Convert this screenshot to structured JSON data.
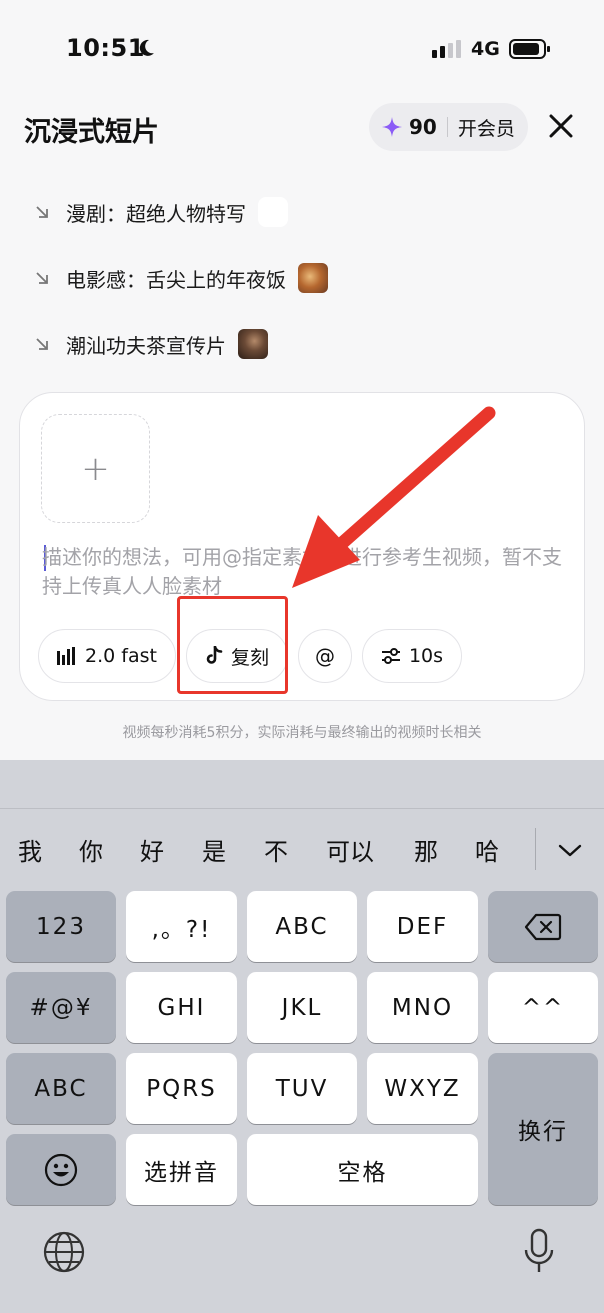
{
  "status": {
    "time": "10:51",
    "network": "4G"
  },
  "header": {
    "title": "沉浸式短片",
    "points": "90",
    "vip_label": "开会员"
  },
  "suggestions": [
    {
      "label": "漫剧：超绝人物特写"
    },
    {
      "label": "电影感：舌尖上的年夜饭"
    },
    {
      "label": "潮汕功夫茶宣传片"
    }
  ],
  "composer": {
    "placeholder": "描述你的想法，可用@指定素材，进行参考生视频，暂不支持上传真人人脸素材",
    "chips": {
      "model": "2.0 fast",
      "copy": "复刻",
      "mention": "@",
      "duration": "10s"
    }
  },
  "note": "视频每秒消耗5积分，实际消耗与最终输出的视频时长相关",
  "keyboard": {
    "candidates": [
      "我",
      "你",
      "好",
      "是",
      "不",
      "可以",
      "那",
      "哈"
    ],
    "keys": {
      "num": "123",
      "punct": ",。?!",
      "abc": "ABC",
      "def": "DEF",
      "symbols": "#@¥",
      "ghi": "GHI",
      "jkl": "JKL",
      "mno": "MNO",
      "emoticon": "^^",
      "abc_switch": "ABC",
      "pqrs": "PQRS",
      "tuv": "TUV",
      "wxyz": "WXYZ",
      "enter": "换行",
      "pinyin": "选拼音",
      "space": "空格"
    }
  },
  "colors": {
    "accent": "#8b5cf6",
    "highlight": "#e8362b"
  }
}
